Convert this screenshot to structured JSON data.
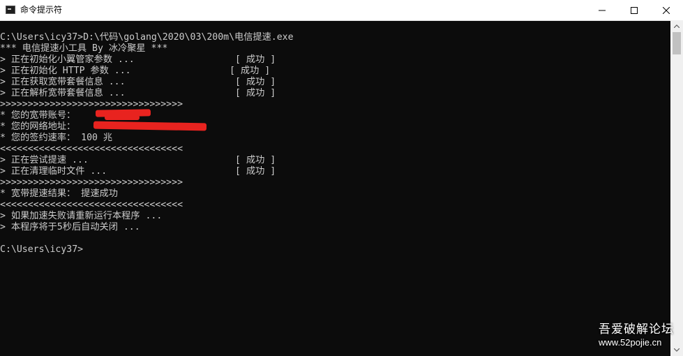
{
  "window": {
    "title": "命令提示符",
    "icon": "cmd-icon"
  },
  "console": {
    "lines": [
      "C:\\Users\\icy37>D:\\代码\\golang\\2020\\03\\200m\\电信提速.exe",
      "*** 电信提速小工具 By 冰冷聚星 ***",
      "> 正在初始化小翼管家参数 ...",
      "> 正在初始化 HTTP 参数 ...",
      "> 正在获取宽带套餐信息 ...",
      "> 正在解析宽带套餐信息 ...",
      ">>>>>>>>>>>>>>>>>>>>>>>>>>>>>>>>>",
      "* 您的宽带账号：",
      "* 您的网络地址：",
      "* 您的签约速率： 100 兆",
      "<<<<<<<<<<<<<<<<<<<<<<<<<<<<<<<<<",
      "> 正在尝试提速 ...",
      "> 正在清理临时文件 ...",
      ">>>>>>>>>>>>>>>>>>>>>>>>>>>>>>>>>",
      "* 宽带提速结果： 提速成功",
      "<<<<<<<<<<<<<<<<<<<<<<<<<<<<<<<<<",
      "> 如果加速失败请重新运行本程序 ...",
      "> 本程序将于5秒后自动关闭 ...",
      "",
      "C:\\Users\\icy37>"
    ],
    "statuses": [
      "[ 成功 ]",
      "[ 成功 ]",
      "[ 成功 ]",
      "[ 成功 ]",
      "[ 成功 ]",
      "[ 成功 ]"
    ]
  },
  "watermark": {
    "line1": "吾爱破解论坛",
    "line2": "www.52pojie.cn"
  },
  "colors": {
    "console_bg": "#0c0c0c",
    "console_text": "#cccccc",
    "redaction": "#e8231f"
  }
}
